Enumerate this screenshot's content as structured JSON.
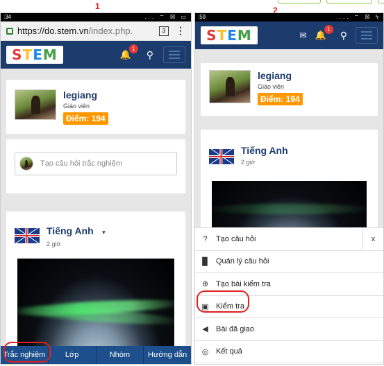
{
  "labels": {
    "step1": "1",
    "step2": "2"
  },
  "phone1": {
    "status": {
      "time": ":34",
      "icons": "... ⌔ ☒ ▭"
    },
    "browser": {
      "url_host": "https://do.stem.vn",
      "url_path": "/index.php.",
      "tab_count": "3",
      "menu": "⋮"
    },
    "nav": {
      "logo": "STEM",
      "notif_count": "1"
    },
    "profile": {
      "name": "legiang",
      "role": "Giáo viên",
      "points": "Điểm: 194"
    },
    "composer": {
      "placeholder": "Tạo câu hỏi trắc nghiệm"
    },
    "post": {
      "title": "Tiếng Anh",
      "caret": "▾",
      "time": "2 giờ"
    },
    "bottom_nav": [
      "Trắc nghiệm",
      "Lớp",
      "Nhóm",
      "Hướng dẫn"
    ]
  },
  "phone2": {
    "status": {
      "time": ":59",
      "icons": "... ⌔ ☒ ϟ"
    },
    "nav": {
      "logo": "STEM",
      "notif_count": "1"
    },
    "profile": {
      "name": "legiang",
      "role": "Giáo viên",
      "points": "Điểm: 194"
    },
    "post": {
      "title": "Tiếng Anh",
      "time": "2 giờ"
    },
    "menu": {
      "close": "x",
      "items": [
        "Tạo câu hỏi",
        "Quản lý câu hỏi",
        "Tạo bài kiểm tra",
        "Kiểm tra",
        "Bài đã giao",
        "Kết quả"
      ]
    }
  },
  "colors": {
    "navbar": "#1d3c6e",
    "bottom_nav": "#1d4f8c",
    "points": "#ff9800",
    "badge": "#e53935",
    "highlight": "#e02020"
  }
}
